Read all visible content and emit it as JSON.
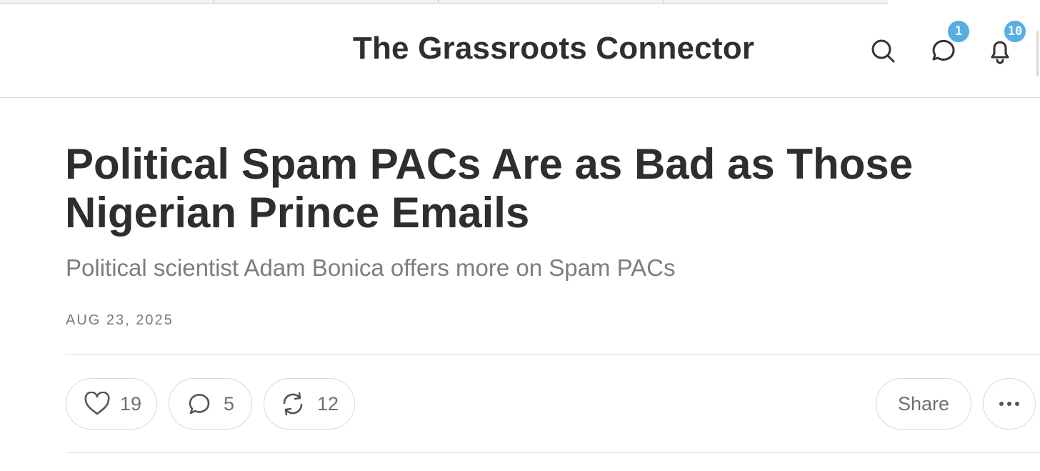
{
  "header": {
    "site_title": "The Grassroots Connector",
    "messages_badge": "1",
    "notifications_badge": "10",
    "badge_color": "#56aee2"
  },
  "post": {
    "title": "Political Spam PACs Are as Bad as Those Nigerian Prince Emails",
    "subtitle": "Political scientist Adam Bonica offers more on Spam PACs",
    "date": "AUG 23, 2025"
  },
  "actions": {
    "likes": "19",
    "comments": "5",
    "restacks": "12",
    "share_label": "Share"
  },
  "icons": {
    "search": "search-icon",
    "messages": "chat-bubble-icon",
    "notifications": "bell-icon",
    "like": "heart-icon",
    "comment": "comment-icon",
    "restack": "refresh-icon",
    "more": "more-icon"
  }
}
